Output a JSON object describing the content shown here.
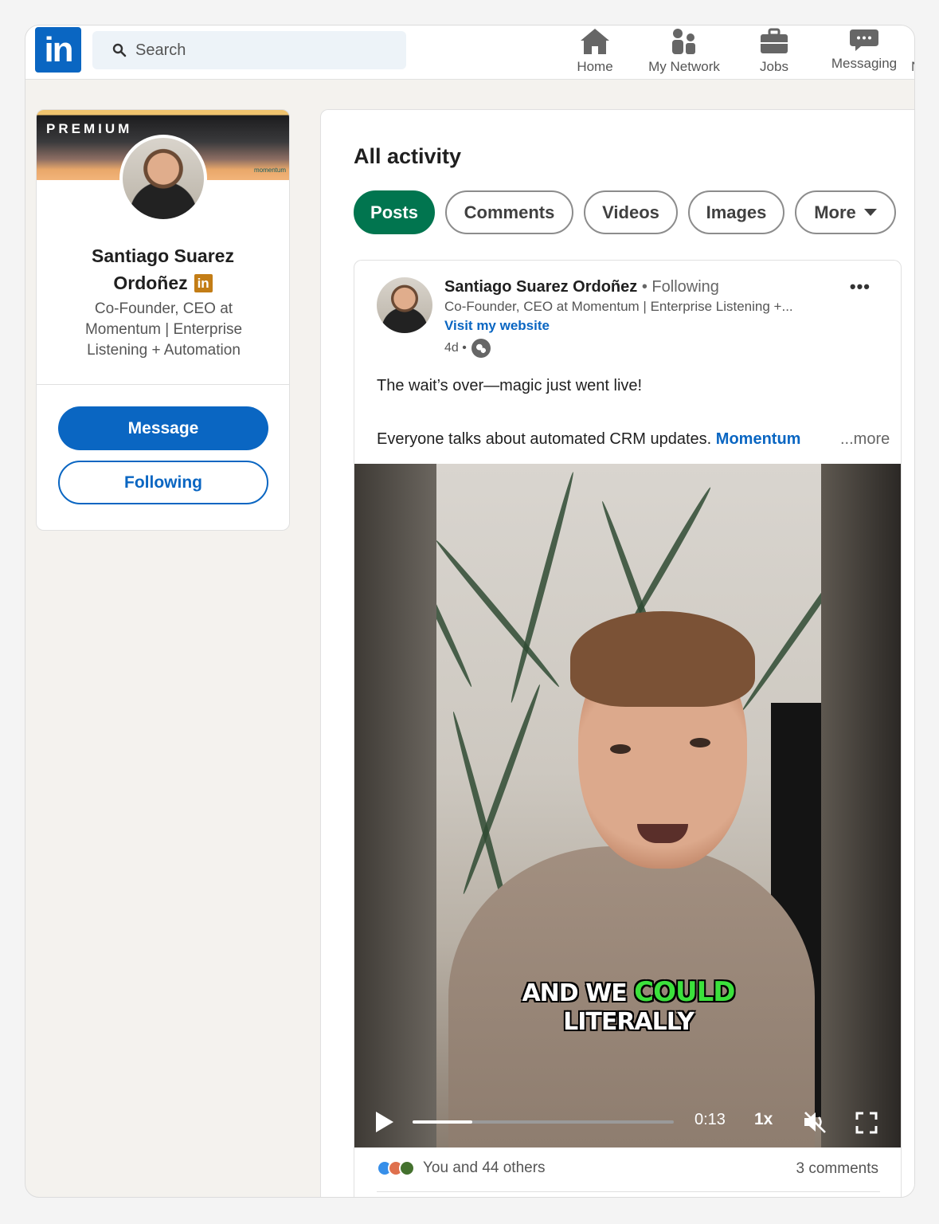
{
  "nav": {
    "logo_text": "in",
    "search_placeholder": "Search",
    "items": [
      {
        "label": "Home",
        "icon": "home-icon"
      },
      {
        "label": "My Network",
        "icon": "people-icon"
      },
      {
        "label": "Jobs",
        "icon": "briefcase-icon"
      },
      {
        "label": "Messaging",
        "icon": "chat-icon"
      }
    ],
    "brand_color": "#0a66c2"
  },
  "profile": {
    "banner_label": "PREMIUM",
    "banner_brand": "momentum",
    "name_line1": "Santiago Suarez",
    "name_line2": "Ordoñez",
    "badge_text": "in",
    "headline": "Co-Founder, CEO at Momentum | Enterprise Listening + Automation",
    "message_label": "Message",
    "following_label": "Following"
  },
  "activity": {
    "title": "All activity",
    "tabs": [
      {
        "label": "Posts",
        "active": true
      },
      {
        "label": "Comments",
        "active": false
      },
      {
        "label": "Videos",
        "active": false
      },
      {
        "label": "Images",
        "active": false
      },
      {
        "label": "More",
        "active": false
      }
    ],
    "active_color": "#01754f"
  },
  "post": {
    "author": "Santiago Suarez Ordoñez",
    "separator": "•",
    "follow_status": "Following",
    "subtitle": "Co-Founder, CEO at Momentum | Enterprise Listening +...",
    "link": "Visit my website",
    "age": "4d •",
    "more_icon": "•••",
    "text1": "The wait’s over—magic just went live!",
    "text2": "Everyone talks about automated CRM updates.",
    "mention": "Momentum",
    "see_more": "...more",
    "video": {
      "caption_white1": "AND WE",
      "caption_green": "COULD",
      "caption_white2": "LITERALLY",
      "time": "0:13",
      "speed": "1x",
      "progress_fraction": 0.23
    },
    "reactions_text": "You and 44 others",
    "comments_text": "3 comments"
  }
}
